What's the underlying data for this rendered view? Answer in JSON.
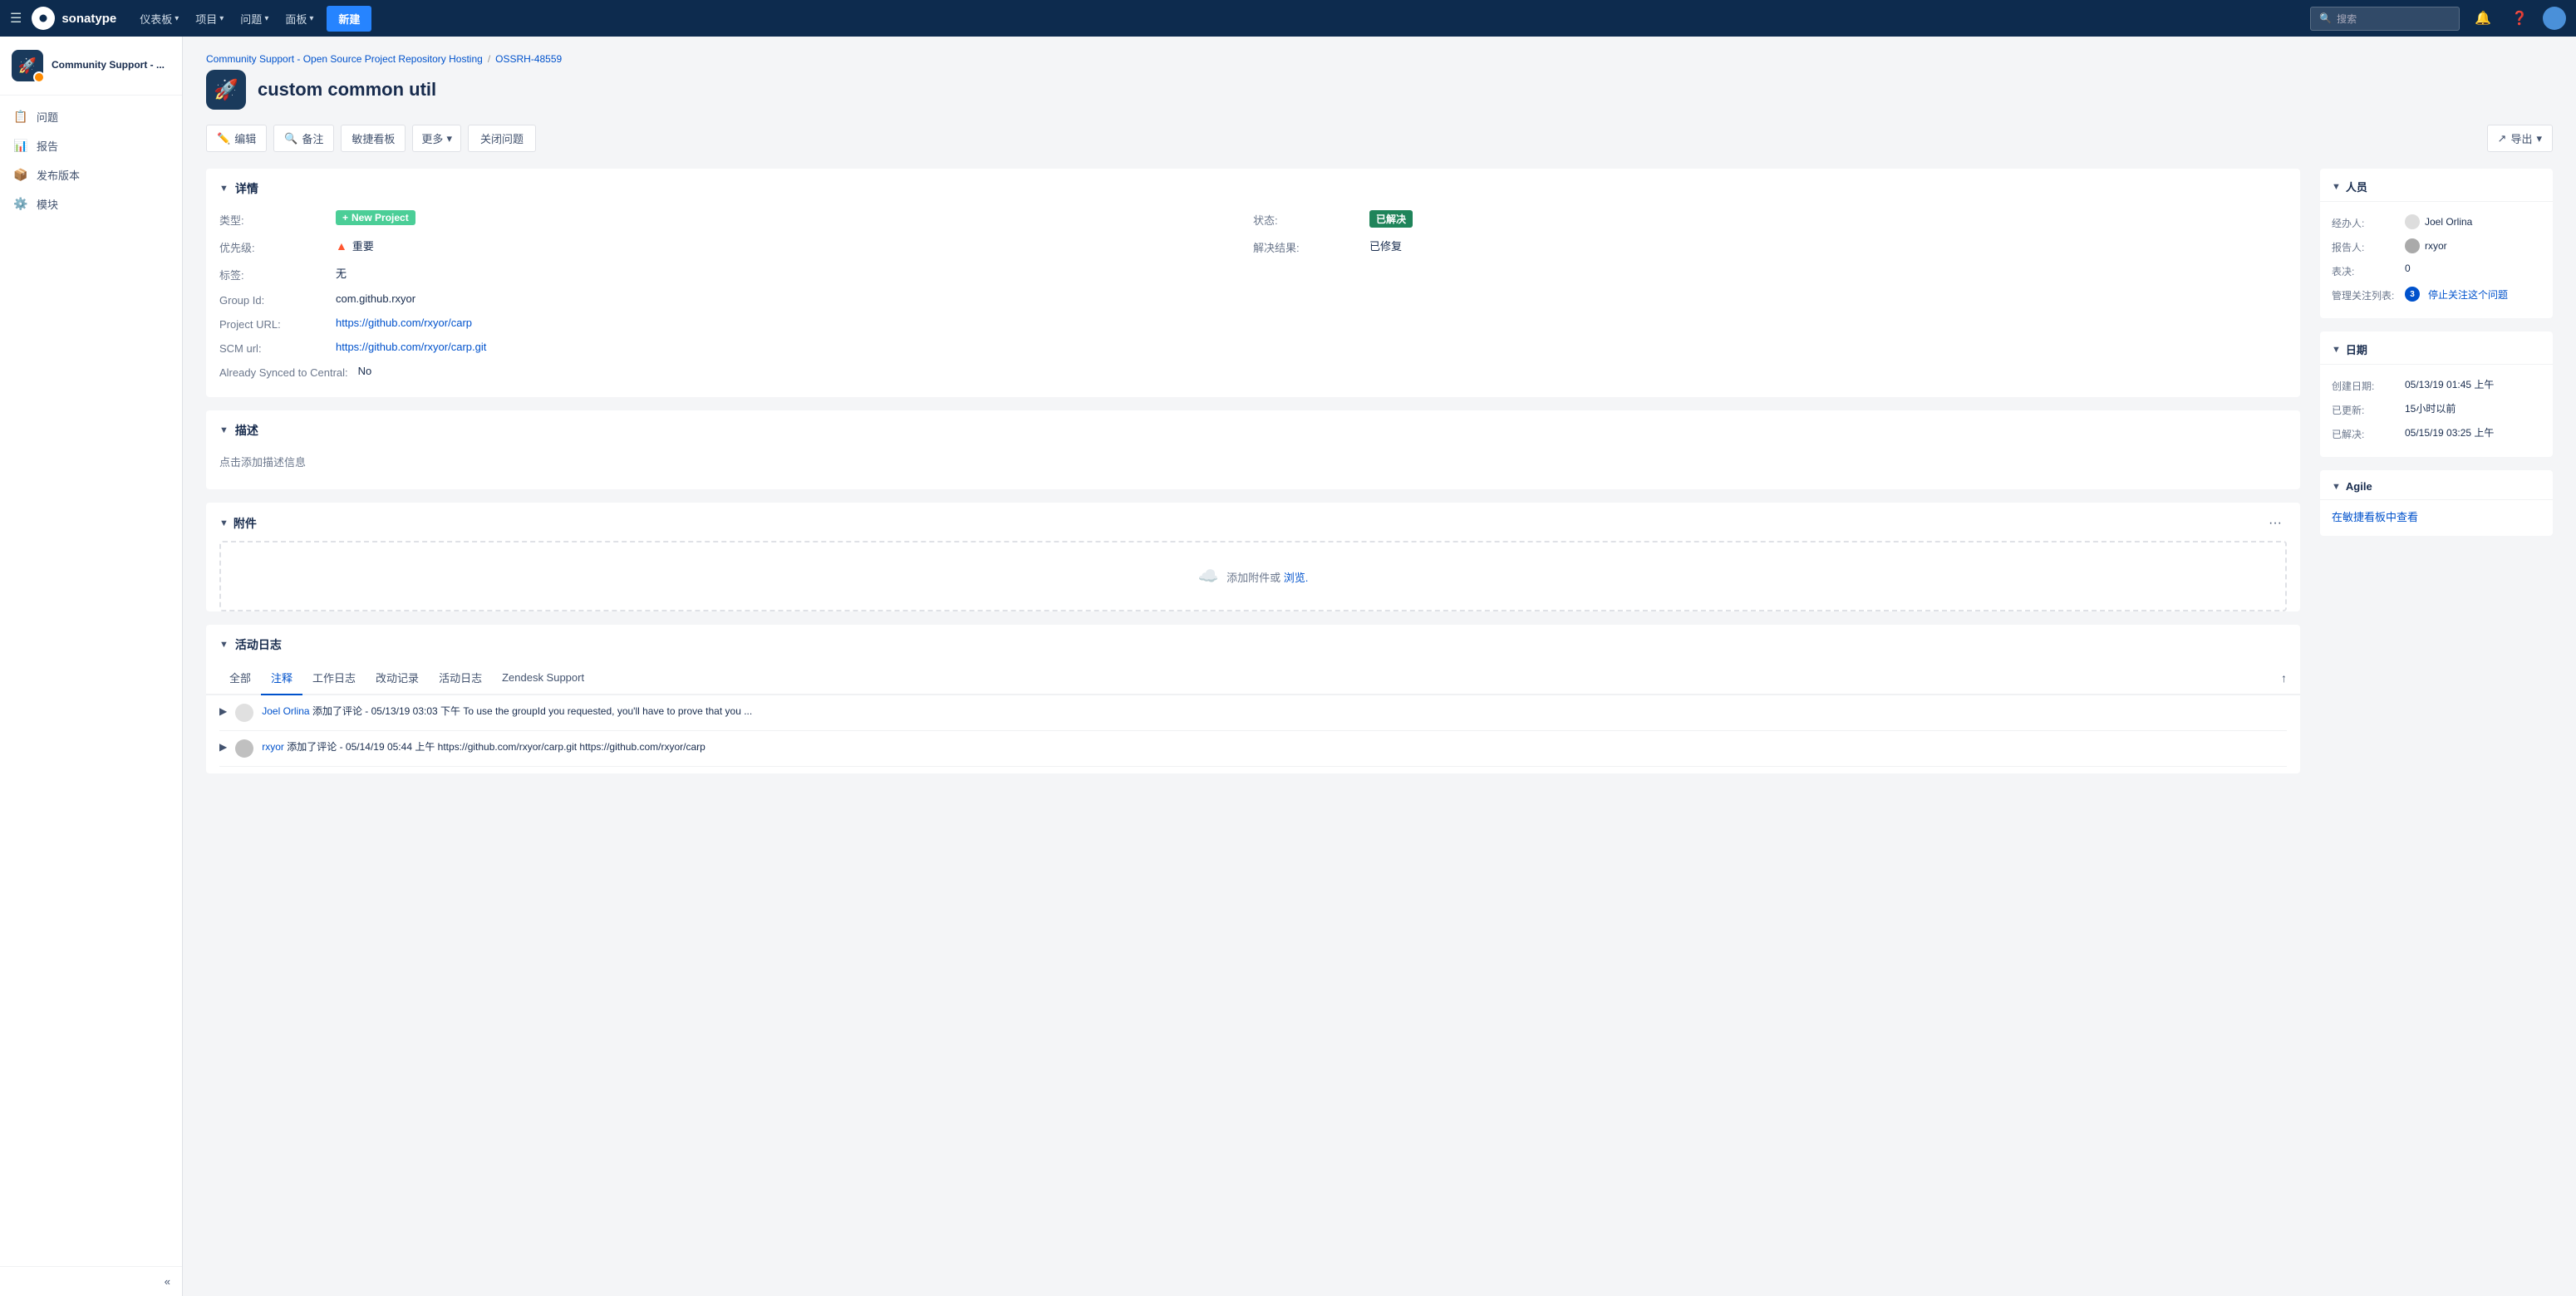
{
  "topnav": {
    "logo_text": "sonatype",
    "nav_items": [
      {
        "label": "仪表板",
        "has_dropdown": true
      },
      {
        "label": "项目",
        "has_dropdown": true
      },
      {
        "label": "问题",
        "has_dropdown": true
      },
      {
        "label": "面板",
        "has_dropdown": true
      }
    ],
    "new_btn_label": "新建",
    "search_placeholder": "搜索"
  },
  "sidebar": {
    "project_name": "Community Support - ...",
    "nav_items": [
      {
        "label": "问题",
        "icon": "📋"
      },
      {
        "label": "报告",
        "icon": "📊"
      },
      {
        "label": "发布版本",
        "icon": "📦"
      },
      {
        "label": "模块",
        "icon": "⚙️"
      }
    ]
  },
  "breadcrumb": {
    "project": "Community Support - Open Source Project Repository Hosting",
    "separator": "/",
    "issue_id": "OSSRH-48559"
  },
  "page": {
    "icon": "🚀",
    "title": "custom common util"
  },
  "toolbar": {
    "edit_label": "编辑",
    "comment_label": "备注",
    "agile_label": "敏捷看板",
    "more_label": "更多",
    "close_label": "关闭问题",
    "export_label": "导出"
  },
  "details": {
    "section_title": "详情",
    "type_label": "类型:",
    "type_value": "New Project",
    "priority_label": "优先级:",
    "priority_value": "重要",
    "tags_label": "标签:",
    "tags_value": "无",
    "group_id_label": "Group Id:",
    "group_id_value": "com.github.rxyor",
    "project_url_label": "Project URL:",
    "project_url_value": "https://github.com/rxyor/carp",
    "scm_url_label": "SCM url:",
    "scm_url_value": "https://github.com/rxyor/carp.git",
    "synced_label": "Already Synced to Central:",
    "synced_value": "No",
    "status_label": "状态:",
    "status_value": "已解决",
    "resolution_label": "解决结果:",
    "resolution_value": "已修复"
  },
  "description": {
    "section_title": "描述",
    "placeholder": "点击添加描述信息"
  },
  "attachment": {
    "section_title": "附件",
    "drop_text": "添加附件或",
    "drop_link": "浏览."
  },
  "activity": {
    "section_title": "活动日志",
    "tabs": [
      {
        "label": "全部"
      },
      {
        "label": "注释",
        "active": true
      },
      {
        "label": "工作日志"
      },
      {
        "label": "改动记录"
      },
      {
        "label": "活动日志"
      },
      {
        "label": "Zendesk Support"
      }
    ],
    "items": [
      {
        "author": "Joel Orlina",
        "action": "添加了评论 - 05/13/19 03:03 下午",
        "text": "To use the groupId you requested, you'll have to prove that you ..."
      },
      {
        "author": "rxyor",
        "action": "添加了评论 - 05/14/19 05:44 上午",
        "text": "https://github.com/rxyor/carp.git https://github.com/rxyor/carp"
      }
    ]
  },
  "people": {
    "section_title": "人员",
    "assignee_label": "经办人:",
    "assignee_name": "Joel Orlina",
    "reporter_label": "报告人:",
    "reporter_name": "rxyor",
    "votes_label": "表决:",
    "votes_value": "0",
    "watch_label": "管理关注列表:",
    "watch_count": "3",
    "watch_action": "停止关注这个问题"
  },
  "dates": {
    "section_title": "日期",
    "created_label": "创建日期:",
    "created_value": "05/13/19 01:45 上午",
    "updated_label": "已更新:",
    "updated_value": "15小时以前",
    "resolved_label": "已解决:",
    "resolved_value": "05/15/19 03:25 上午"
  },
  "agile": {
    "section_title": "Agile",
    "view_link": "在敏捷看板中查看"
  }
}
